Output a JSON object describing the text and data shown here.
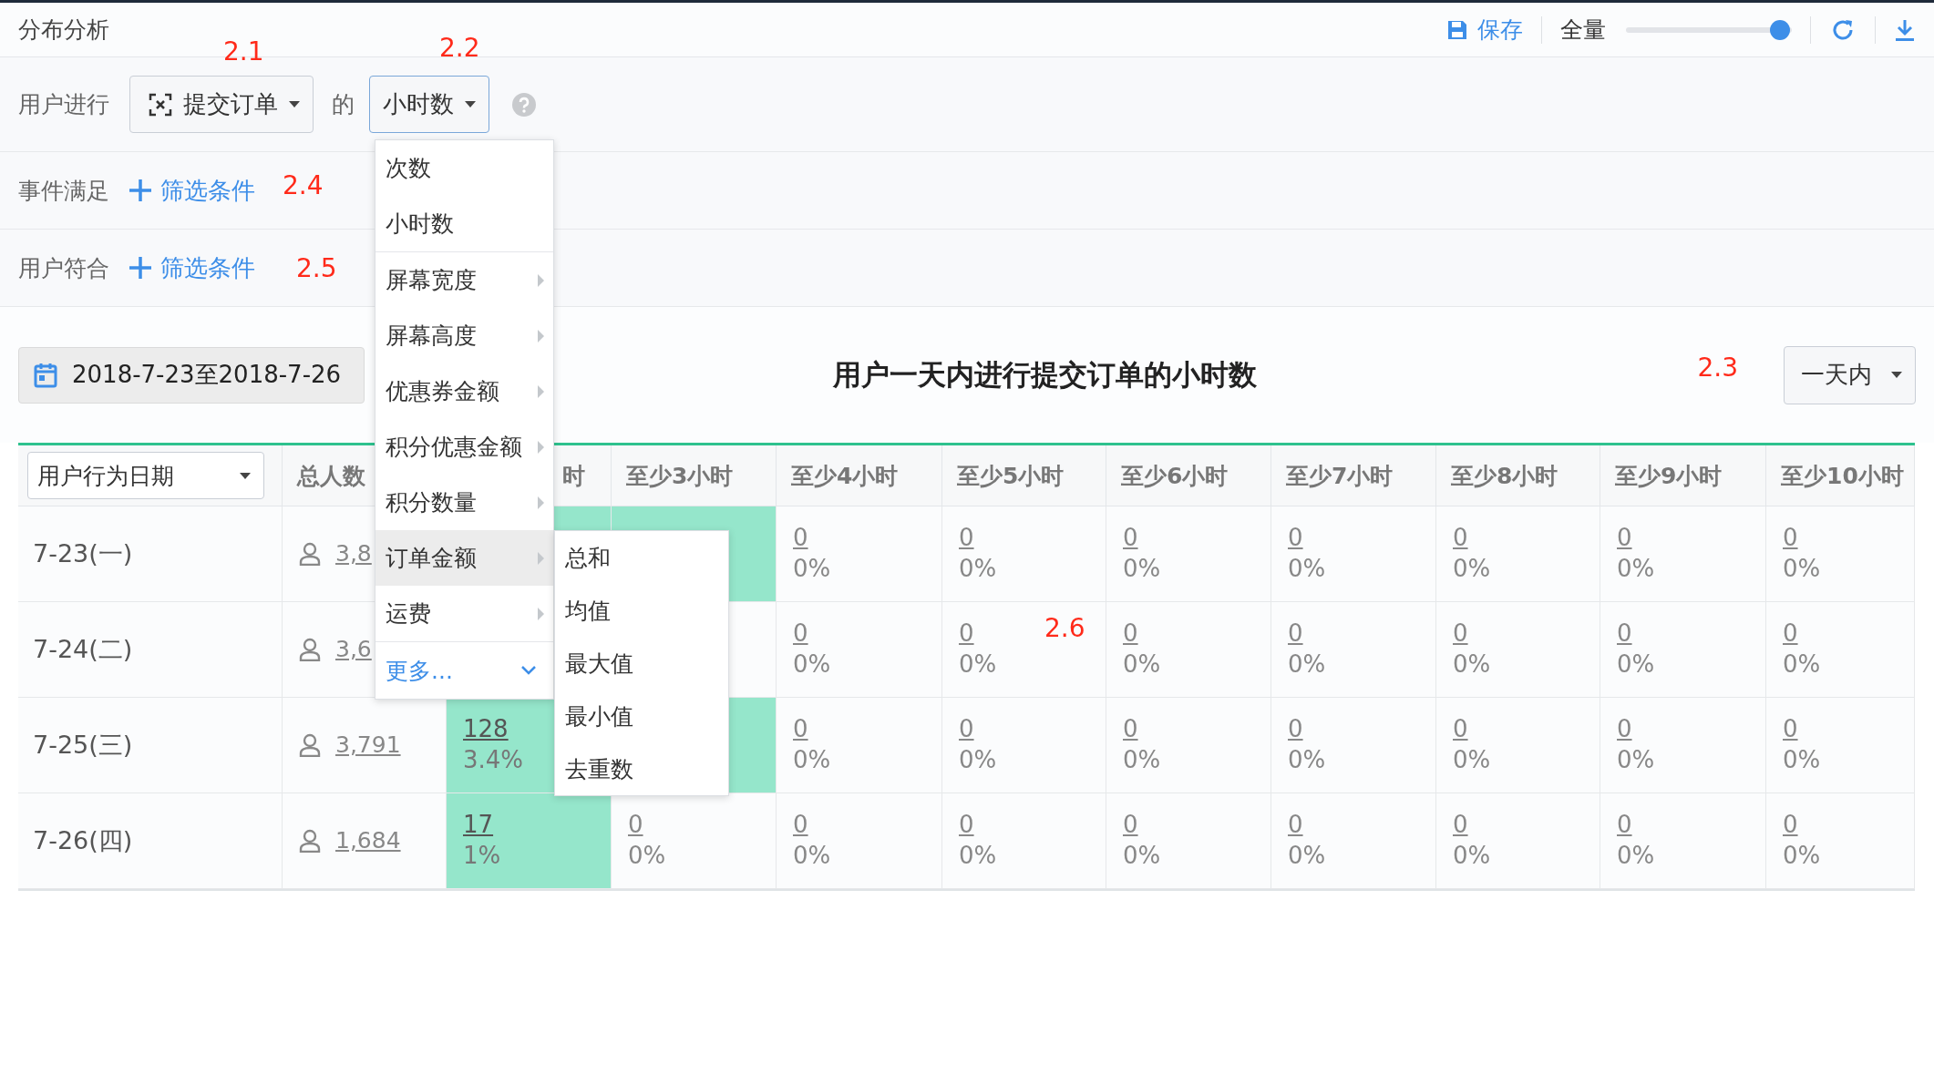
{
  "header": {
    "title": "分布分析",
    "save_label": "保存",
    "scope_label": "全量",
    "scope_slider": {
      "level": 0.93
    }
  },
  "query": {
    "prefix": "用户进行",
    "event_select": {
      "value": "提交订单",
      "annotation": "2.1"
    },
    "connector": "的",
    "measure_select": {
      "value": "小时数",
      "expanded": true,
      "annotation": "2.2"
    }
  },
  "filters": [
    {
      "label": "事件满足",
      "link": "筛选条件",
      "annotation": "2.4"
    },
    {
      "label": "用户符合",
      "link": "筛选条件",
      "annotation": "2.5"
    }
  ],
  "date_range": "2018-7-23至2018-7-26",
  "chart_title": "用户一天内进行提交订单的小时数",
  "period_select": {
    "value": "一天内",
    "annotation": "2.3"
  },
  "table": {
    "date_select": "用户行为日期",
    "total_header": "总人数",
    "columns": [
      "时",
      "至少3小时",
      "至少4小时",
      "至少5小时",
      "至少6小时",
      "至少7小时",
      "至少8小时",
      "至少9小时",
      "至少10小时"
    ],
    "rows": [
      {
        "date": "7-23(一)",
        "total": "3,8",
        "cells": [
          {
            "highlight": true
          },
          {
            "highlight": true
          },
          {
            "count": "0",
            "percent": "0%",
            "highlight": false
          },
          {
            "count": "0",
            "percent": "0%",
            "highlight": false
          },
          {
            "count": "0",
            "percent": "0%",
            "highlight": false
          },
          {
            "count": "0",
            "percent": "0%",
            "highlight": false
          },
          {
            "count": "0",
            "percent": "0%",
            "highlight": false
          },
          {
            "count": "0",
            "percent": "0%",
            "highlight": false
          },
          {
            "count": "0",
            "percent": "0%",
            "highlight": false
          }
        ]
      },
      {
        "date": "7-24(二)",
        "total": "3,6",
        "cells": [
          null,
          {
            "highlight": false
          },
          {
            "count": "0",
            "percent": "0%",
            "highlight": false
          },
          {
            "count": "0",
            "percent": "0%",
            "highlight": false,
            "annotation": "2.6"
          },
          {
            "count": "0",
            "percent": "0%",
            "highlight": false
          },
          {
            "count": "0",
            "percent": "0%",
            "highlight": false
          },
          {
            "count": "0",
            "percent": "0%",
            "highlight": false
          },
          {
            "count": "0",
            "percent": "0%",
            "highlight": false
          },
          {
            "count": "0",
            "percent": "0%",
            "highlight": false
          }
        ]
      },
      {
        "date": "7-25(三)",
        "total": "3,791",
        "cells": [
          {
            "count": "128",
            "percent": "3.4%",
            "highlight": true
          },
          {
            "highlight": true
          },
          {
            "count": "0",
            "percent": "0%",
            "highlight": false
          },
          {
            "count": "0",
            "percent": "0%",
            "highlight": false
          },
          {
            "count": "0",
            "percent": "0%",
            "highlight": false
          },
          {
            "count": "0",
            "percent": "0%",
            "highlight": false
          },
          {
            "count": "0",
            "percent": "0%",
            "highlight": false
          },
          {
            "count": "0",
            "percent": "0%",
            "highlight": false
          },
          {
            "count": "0",
            "percent": "0%",
            "highlight": false
          }
        ]
      },
      {
        "date": "7-26(四)",
        "total": "1,684",
        "cells": [
          {
            "count": "17",
            "percent": "1%",
            "highlight": true
          },
          {
            "count": "0",
            "percent": "0%",
            "highlight": false
          },
          {
            "count": "0",
            "percent": "0%",
            "highlight": false
          },
          {
            "count": "0",
            "percent": "0%",
            "highlight": false
          },
          {
            "count": "0",
            "percent": "0%",
            "highlight": false
          },
          {
            "count": "0",
            "percent": "0%",
            "highlight": false
          },
          {
            "count": "0",
            "percent": "0%",
            "highlight": false
          },
          {
            "count": "0",
            "percent": "0%",
            "highlight": false
          },
          {
            "count": "0",
            "percent": "0%",
            "highlight": false
          }
        ]
      }
    ]
  },
  "measure_menu": {
    "groups": [
      [
        {
          "label": "次数",
          "has_submenu": false,
          "selected": false
        },
        {
          "label": "小时数",
          "has_submenu": false,
          "selected": false
        }
      ],
      [
        {
          "label": "屏幕宽度",
          "has_submenu": true,
          "selected": false
        },
        {
          "label": "屏幕高度",
          "has_submenu": true,
          "selected": false
        },
        {
          "label": "优惠券金额",
          "has_submenu": true,
          "selected": false
        },
        {
          "label": "积分优惠金额",
          "has_submenu": true,
          "selected": false
        },
        {
          "label": "积分数量",
          "has_submenu": true,
          "selected": false
        },
        {
          "label": "订单金额",
          "has_submenu": true,
          "selected": true,
          "submenu_items": [
            "总和",
            "均值",
            "最大值",
            "最小值",
            "去重数"
          ]
        },
        {
          "label": "运费",
          "has_submenu": true,
          "selected": false
        }
      ]
    ],
    "more": "更多..."
  }
}
